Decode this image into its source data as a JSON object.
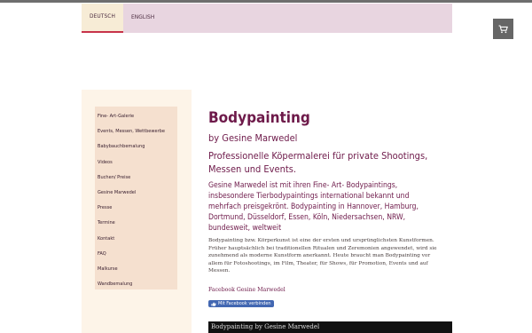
{
  "lang": {
    "items": [
      "DEUTSCH",
      "ENGLISH"
    ],
    "active": "DEUTSCH"
  },
  "cart": {
    "icon": "cart-icon"
  },
  "sidebar": {
    "items": [
      "Fine- Art-Galerie",
      "Events, Messen, Wettbewerbe",
      "Babybauchbemalung",
      "Videos",
      "Buchen/ Preise",
      "Gesine Marwedel",
      "Presse",
      "Termine",
      "Kontakt",
      "FAQ",
      "Malkurse",
      "Wandbemalung"
    ]
  },
  "content": {
    "title": "Bodypainting",
    "byline": "by Gesine Marwedel",
    "subtitle": "Professionelle Köpermalerei für private Shootings, Messen und Events.",
    "intro": "Gesine Marwedel ist mit ihren Fine- Art- Bodypaintings, insbesondere Tierbodypaintings international bekannt und mehrfach preisgekrönt. Bodypainting in Hannover, Hamburg, Dortmund, Düsseldorf, Essen, Köln, Niedersachsen, NRW, bundesweit, weltweit",
    "body": "Bodypainting bzw. Körperkunst ist eine der ersten und ursprünglichsten Kunstformen. Früher hauptsächlich bei traditionellen Ritualen und Zeremonien angewendet, wird sie zunehmend als moderne Kunstform anerkannt. Heute braucht man Bodypainting vor allem für Fotoshootings, im Film, Theater, für Shows, für Promotion, Events und auf Messen.",
    "facebook_label": "Facebook Gesine Marwedel",
    "facebook_button": "Mit Facebook verbinden",
    "embed_title": "Bodypainting by Gesine Marwedel"
  },
  "colors": {
    "accent": "#6e1a4a",
    "langbar": "#e8d5e0",
    "sidebar": "#f5e0cf",
    "active_underline": "#c7334a"
  }
}
